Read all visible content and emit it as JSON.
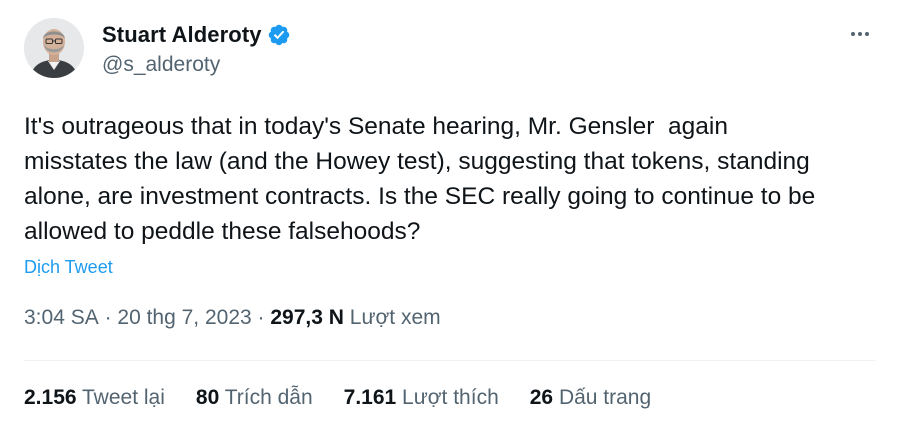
{
  "author": {
    "display_name": "Stuart Alderoty",
    "handle": "@s_alderoty",
    "verified": true,
    "verified_color": "#1d9bf0"
  },
  "more_icon": "ellipsis-icon",
  "tweet": {
    "text": "It's outrageous that in today's Senate hearing, Mr. Gensler  again\nmisstates the law (and the Howey test), suggesting that tokens, standing\nalone, are investment contracts. Is the SEC really going to continue to be\nallowed to peddle these falsehoods?",
    "translate_label": "Dịch Tweet"
  },
  "meta": {
    "time": "3:04 SA",
    "separator": " · ",
    "date": "20 thg 7, 2023",
    "separator2": " · ",
    "views_count": "297,3 N",
    "views_label": " Lượt xem"
  },
  "stats": {
    "retweets": {
      "count": "2.156",
      "label": " Tweet lại"
    },
    "quotes": {
      "count": "80",
      "label": " Trích dẫn"
    },
    "likes": {
      "count": "7.161",
      "label": " Lượt thích"
    },
    "bookmarks": {
      "count": "26",
      "label": " Dấu trang"
    }
  },
  "colors": {
    "link": "#1d9bf0",
    "secondary_text": "#536471",
    "primary_text": "#0f1419"
  }
}
